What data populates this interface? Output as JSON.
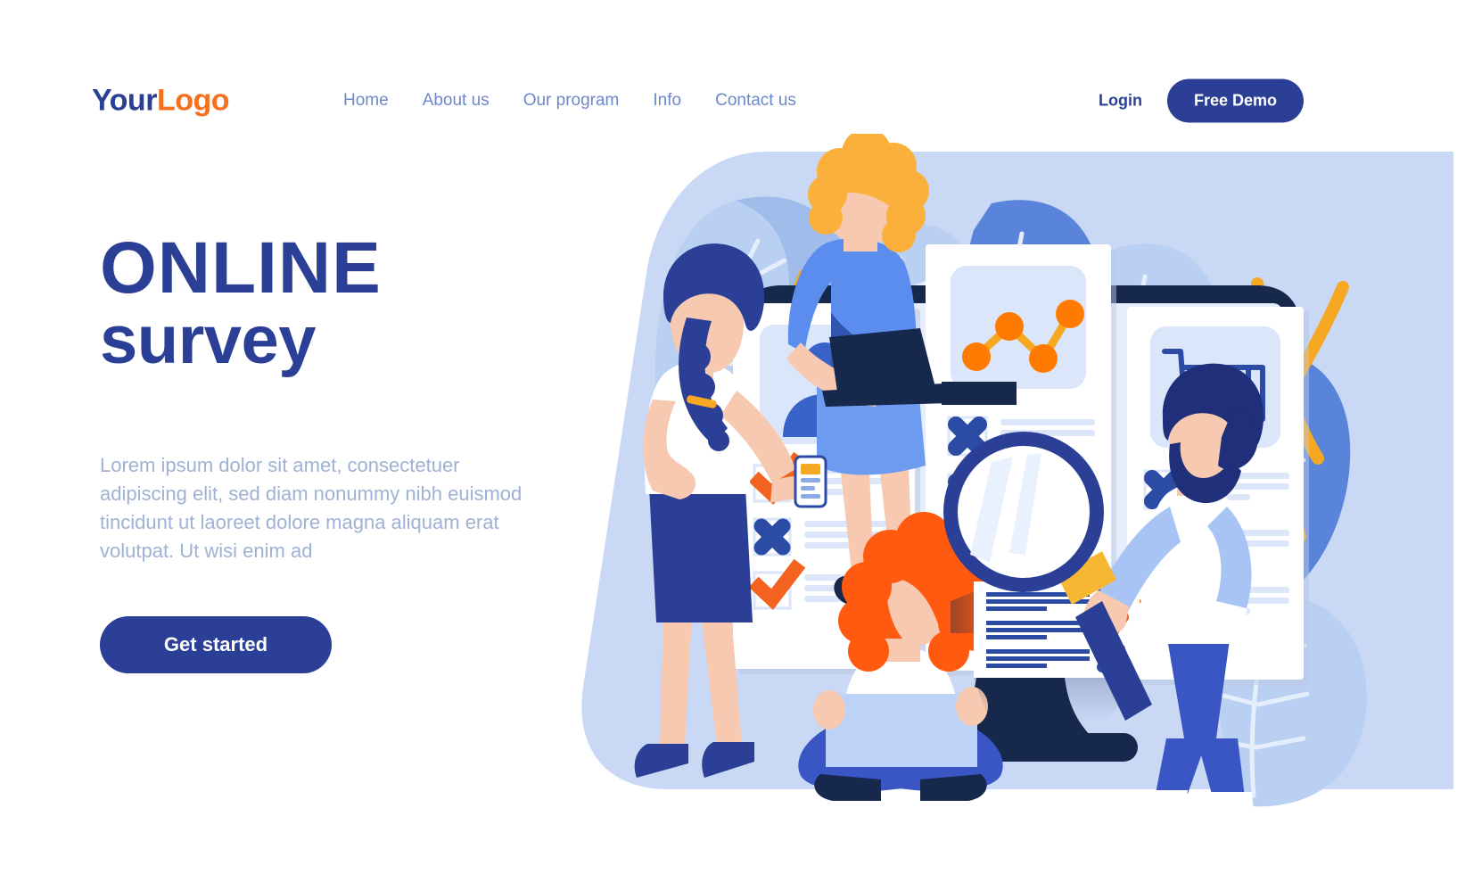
{
  "header": {
    "logo": {
      "part1": "Your",
      "part2": "Logo",
      "color1": "#2b3f96",
      "color2": "#f4711f"
    },
    "nav": [
      {
        "label": "Home"
      },
      {
        "label": "About us"
      },
      {
        "label": "Our program"
      },
      {
        "label": "Info"
      },
      {
        "label": "Contact us"
      }
    ],
    "login_label": "Login",
    "demo_label": "Free Demo",
    "nav_color": "#6d88c8",
    "button_color": "#2b3f96"
  },
  "hero": {
    "title_line1": "ONLINE",
    "title_line2": "survey",
    "paragraph": "Lorem ipsum dolor sit amet, consectetuer adipiscing elit, sed diam nonummy nibh euismod tincidunt ut laoreet dolore magna aliquam erat volutpat. Ut wisi enim ad",
    "cta_label": "Get started",
    "title_color": "#2b3f96",
    "paragraph_color": "#9fb1d4"
  },
  "illustration": {
    "alt": "online-survey-illustration",
    "background_blob_color": "#c8d8f5",
    "leaf_colors": {
      "light": "#b9d0f2",
      "mid": "#8aabe4",
      "dark": "#3f62c0",
      "vein": "#e4eefc"
    },
    "stem_color": "#f7a823",
    "monitor_color": "#17284d",
    "screen_color": "#e6eefc",
    "card_color": "#ffffff",
    "check_color": "#f4621f",
    "cross_color": "#2b4ba5",
    "accent_orange": "#ff6b0f",
    "chart_node_color": "#ff7a00",
    "chart_line_color": "#f7a823",
    "cards": [
      {
        "name": "profile-survey-card",
        "icon": "person-icon",
        "rows": [
          {
            "mark": "check",
            "lines": 3
          },
          {
            "mark": "cross",
            "lines": 3
          },
          {
            "mark": "check",
            "lines": 3
          }
        ]
      },
      {
        "name": "analytics-survey-card",
        "icon": "line-chart-icon",
        "rows": [
          {
            "mark": "cross",
            "lines": 3
          },
          {
            "mark": "cross",
            "lines": 3
          },
          {
            "mark": "check",
            "lines": 3
          }
        ]
      },
      {
        "name": "shopping-survey-card",
        "icon": "shopping-cart-icon",
        "rows": [
          {
            "mark": "cross",
            "lines": 3
          },
          {
            "mark": "check",
            "lines": 3
          },
          {
            "mark": "check",
            "lines": 3
          }
        ]
      }
    ],
    "floating_card": {
      "name": "floating-results-card",
      "rows": [
        {
          "mark": "cross"
        },
        {
          "mark": "check"
        },
        {
          "mark": "cross"
        }
      ]
    },
    "characters": [
      {
        "name": "woman-with-laptop-on-monitor",
        "hair": "#fbb03b",
        "top": "#5b8def",
        "skirt": "#6c9bf0"
      },
      {
        "name": "woman-with-phone",
        "hair": "#2b3f96",
        "top": "#ffffff",
        "skirt": "#2b3f96"
      },
      {
        "name": "woman-sitting-with-laptop",
        "hair": "#ff5a0f",
        "top": "#ffffff",
        "pants": "#3a56c4"
      },
      {
        "name": "man-with-magnifier",
        "hair": "#1f2f7a",
        "shirt": "#ffffff",
        "pants": "#3a56c4"
      }
    ],
    "magnifier": {
      "name": "magnifier-icon",
      "rim": "#2b3f96",
      "collar": "#f7b733",
      "lens": "#ffffff"
    }
  }
}
